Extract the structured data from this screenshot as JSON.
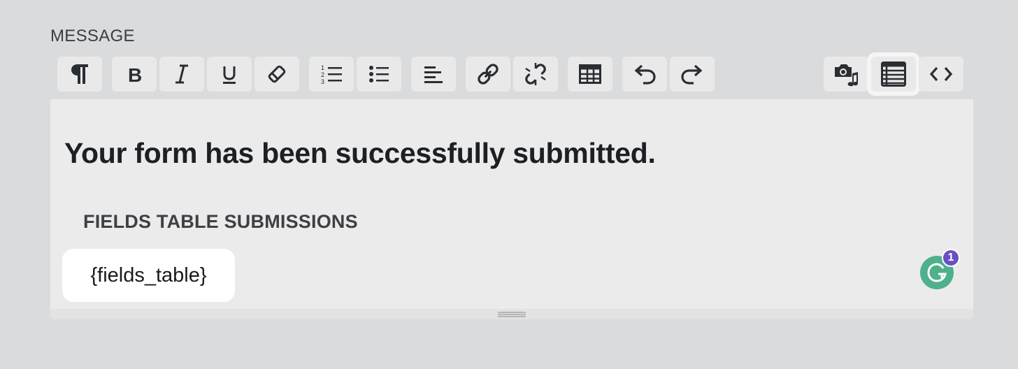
{
  "field": {
    "label": "MESSAGE"
  },
  "toolbar": {
    "buttons": [
      {
        "name": "paragraph-icon",
        "label": "Paragraph"
      },
      {
        "name": "bold-icon",
        "label": "Bold"
      },
      {
        "name": "italic-icon",
        "label": "Italic"
      },
      {
        "name": "underline-icon",
        "label": "Underline"
      },
      {
        "name": "eraser-icon",
        "label": "Clear formatting"
      },
      {
        "name": "ordered-list-icon",
        "label": "Numbered list"
      },
      {
        "name": "bullet-list-icon",
        "label": "Bulleted list"
      },
      {
        "name": "align-left-icon",
        "label": "Align"
      },
      {
        "name": "link-icon",
        "label": "Insert link"
      },
      {
        "name": "unlink-icon",
        "label": "Remove link"
      },
      {
        "name": "table-icon",
        "label": "Insert table"
      },
      {
        "name": "undo-icon",
        "label": "Undo"
      },
      {
        "name": "redo-icon",
        "label": "Redo"
      },
      {
        "name": "media-icon",
        "label": "Insert media"
      },
      {
        "name": "fields-list-icon",
        "label": "Insert field"
      },
      {
        "name": "code-icon",
        "label": "Source code"
      }
    ]
  },
  "editor": {
    "heading": "Your form has been successfully submitted.",
    "subheading": "FIELDS TABLE SUBMISSIONS",
    "token": "{fields_table}"
  },
  "grammarly": {
    "badge_count": "1",
    "color": "#4fb08c",
    "badge_color": "#6a4fc2"
  }
}
